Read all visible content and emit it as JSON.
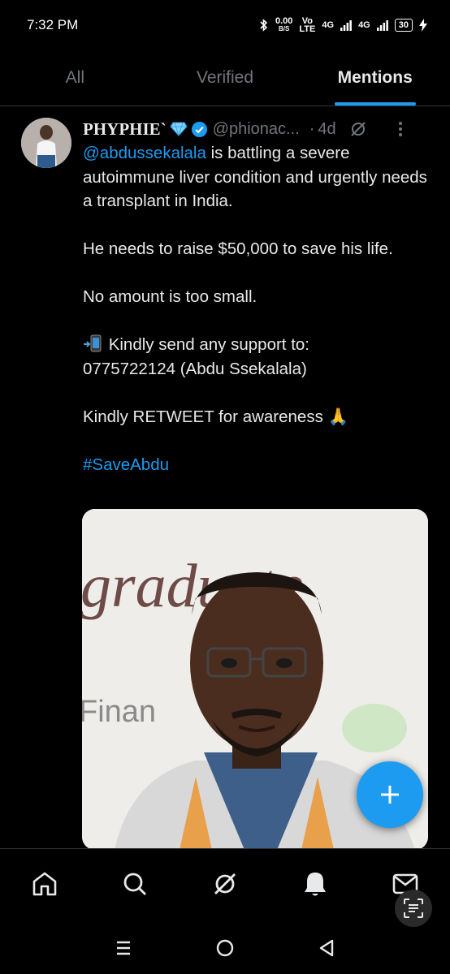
{
  "status_bar": {
    "time": "7:32 PM",
    "net_speed_value": "0.00",
    "net_speed_unit": "B/S",
    "volte_top": "Vo",
    "volte_bottom": "LTE",
    "network_1": "4G",
    "network_2": "4G",
    "battery": "30"
  },
  "tabs": [
    {
      "label": "All",
      "active": false
    },
    {
      "label": "Verified",
      "active": false
    },
    {
      "label": "Mentions",
      "active": true
    }
  ],
  "tweet": {
    "display_name": "PHYPHIE`",
    "handle": "@phionac...",
    "separator": "·",
    "age": "4d",
    "mention": "@abdussekalala",
    "line1_rest": " is battling a severe autoimmune liver condition and urgently needs a transplant in India.",
    "para2": "He needs to raise $50,000 to save his life.",
    "para3": "No amount is too small.",
    "para4_line1": " Kindly send any support to:",
    "para4_line2": "0775722124 (Abdu Ssekalala)",
    "para5": "Kindly RETWEET for awareness 🙏",
    "hashtag": "#SaveAbdu",
    "media_text_top": "graduate",
    "media_text_side": "Finan"
  },
  "colors": {
    "accent": "#1d9bf0",
    "background": "#000000",
    "text_primary": "#e7e9ea",
    "text_secondary": "#71767b"
  },
  "bottom_nav": [
    "home-icon",
    "search-icon",
    "grok-icon",
    "notifications-icon",
    "messages-icon"
  ],
  "system_nav": [
    "recents-icon",
    "home-circle-icon",
    "back-icon"
  ]
}
